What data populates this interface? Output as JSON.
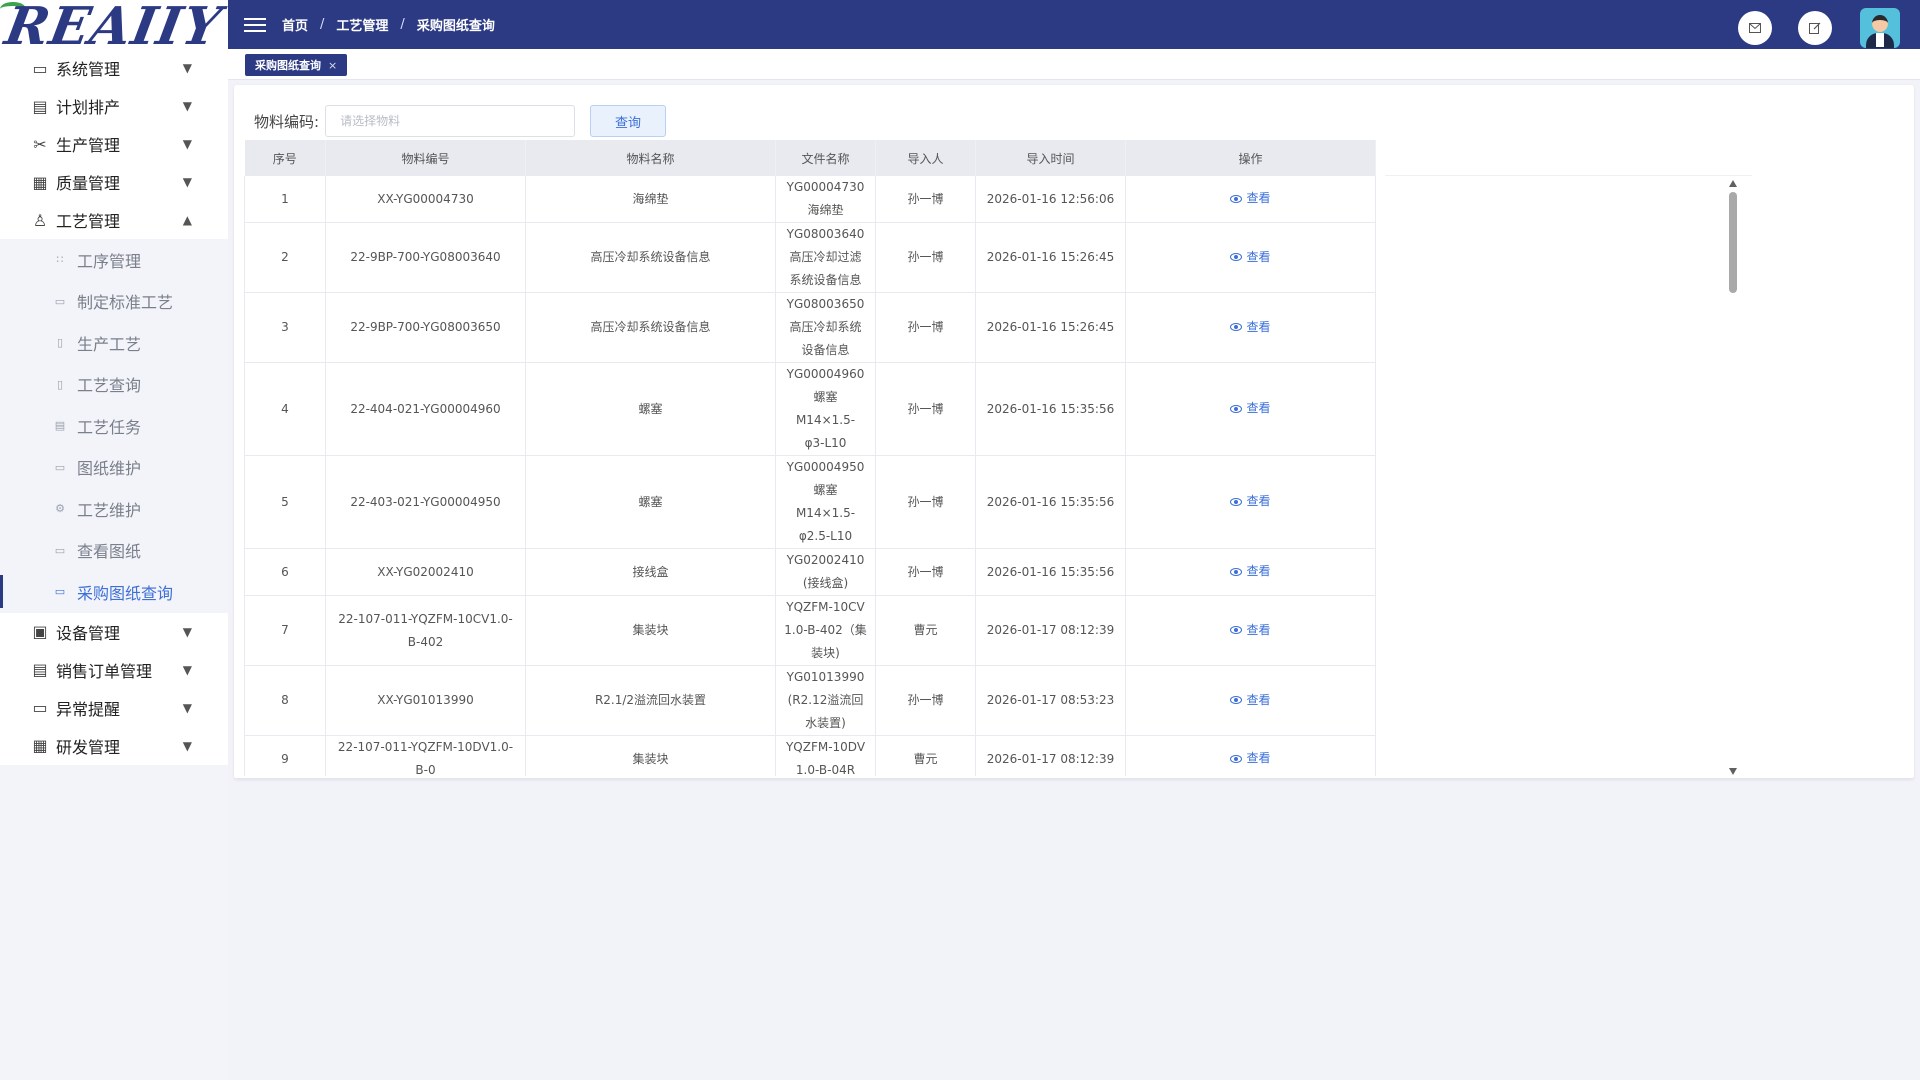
{
  "logo": {
    "text": "REAIIY"
  },
  "header": {
    "breadcrumbs": [
      "首页",
      "工艺管理",
      "采购图纸查询"
    ],
    "separator": "/"
  },
  "tabs": [
    {
      "label": "采购图纸查询",
      "close": "×"
    }
  ],
  "sidebar": {
    "top_items": [
      {
        "label": "系统管理",
        "icon": "monitor-icon",
        "expanded": false
      },
      {
        "label": "计划排产",
        "icon": "calendar-icon",
        "expanded": false
      },
      {
        "label": "生产管理",
        "icon": "tools-icon",
        "expanded": false
      },
      {
        "label": "质量管理",
        "icon": "document-icon",
        "expanded": false
      },
      {
        "label": "工艺管理",
        "icon": "process-icon",
        "expanded": true
      }
    ],
    "sub_items": [
      {
        "label": "工序管理",
        "icon": "grid-icon",
        "active": false
      },
      {
        "label": "制定标准工艺",
        "icon": "template-icon",
        "active": false
      },
      {
        "label": "生产工艺",
        "icon": "file-icon",
        "active": false
      },
      {
        "label": "工艺查询",
        "icon": "search-doc-icon",
        "active": false
      },
      {
        "label": "工艺任务",
        "icon": "task-icon",
        "active": false
      },
      {
        "label": "图纸维护",
        "icon": "drawing-icon",
        "active": false
      },
      {
        "label": "工艺维护",
        "icon": "wrench-icon",
        "active": false
      },
      {
        "label": "查看图纸",
        "icon": "view-drawing-icon",
        "active": false
      },
      {
        "label": "采购图纸查询",
        "icon": "purchase-drawing-icon",
        "active": true
      }
    ],
    "bottom_items": [
      {
        "label": "设备管理",
        "icon": "equipment-icon",
        "expanded": false
      },
      {
        "label": "销售订单管理",
        "icon": "order-icon",
        "expanded": false
      },
      {
        "label": "异常提醒",
        "icon": "alert-icon",
        "expanded": false
      },
      {
        "label": "研发管理",
        "icon": "rd-icon",
        "expanded": false
      }
    ]
  },
  "filter": {
    "label": "物料编码:",
    "placeholder": "请选择物料",
    "value": "",
    "query_button": "查询"
  },
  "table": {
    "columns": [
      "序号",
      "物料编号",
      "物料名称",
      "文件名称",
      "导入人",
      "导入时间",
      "操作"
    ],
    "action_label": "查看",
    "rows": [
      {
        "index": "1",
        "code": "XX-YG00004730",
        "name": "海绵垫",
        "file": [
          "YG00004730",
          "海绵垫"
        ],
        "importer": "孙一博",
        "time": "2026-01-16 12:56:06"
      },
      {
        "index": "2",
        "code": "22-9BP-700-YG08003640",
        "name": "高压冷却系统设备信息",
        "file": [
          "YG08003640",
          "高压冷却过滤",
          "系统设备信息"
        ],
        "importer": "孙一博",
        "time": "2026-01-16 15:26:45"
      },
      {
        "index": "3",
        "code": "22-9BP-700-YG08003650",
        "name": "高压冷却系统设备信息",
        "file": [
          "YG08003650",
          "高压冷却系统",
          "设备信息"
        ],
        "importer": "孙一博",
        "time": "2026-01-16 15:26:45"
      },
      {
        "index": "4",
        "code": "22-404-021-YG00004960",
        "name": "螺塞",
        "file": [
          "YG00004960",
          "螺塞M14×1.5-",
          "φ3-L10"
        ],
        "importer": "孙一博",
        "time": "2026-01-16 15:35:56"
      },
      {
        "index": "5",
        "code": "22-403-021-YG00004950",
        "name": "螺塞",
        "file": [
          "YG00004950",
          "螺塞M14×1.5-",
          "φ2.5-L10"
        ],
        "importer": "孙一博",
        "time": "2026-01-16 15:35:56"
      },
      {
        "index": "6",
        "code": "XX-YG02002410",
        "name": "接线盒",
        "file": [
          "YG02002410",
          "(接线盒)"
        ],
        "importer": "孙一博",
        "time": "2026-01-16 15:35:56"
      },
      {
        "index": "7",
        "code": "22-107-011-YQZFM-10CV1.0-B-402",
        "name": "集装块",
        "file": [
          "YQZFM-10CV",
          "1.0-B-402（集",
          "装块)"
        ],
        "importer": "曹元",
        "time": "2026-01-17 08:12:39"
      },
      {
        "index": "8",
        "code": "XX-YG01013990",
        "name": "R2.1/2溢流回水装置",
        "file": [
          "YG01013990",
          "(R2.12溢流回",
          "水装置)"
        ],
        "importer": "孙一博",
        "time": "2026-01-17 08:53:23"
      },
      {
        "index": "9",
        "code": "22-107-011-YQZFM-10DV1.0-B-0",
        "name": "集装块",
        "file": [
          "YQZFM-10DV",
          "1.0-B-04R"
        ],
        "importer": "曹元",
        "time": "2026-01-17 08:12:39"
      }
    ]
  },
  "colors": {
    "brand": "#2c3a84",
    "link": "#3c6fd8",
    "logo_green": "#3aa34b"
  }
}
